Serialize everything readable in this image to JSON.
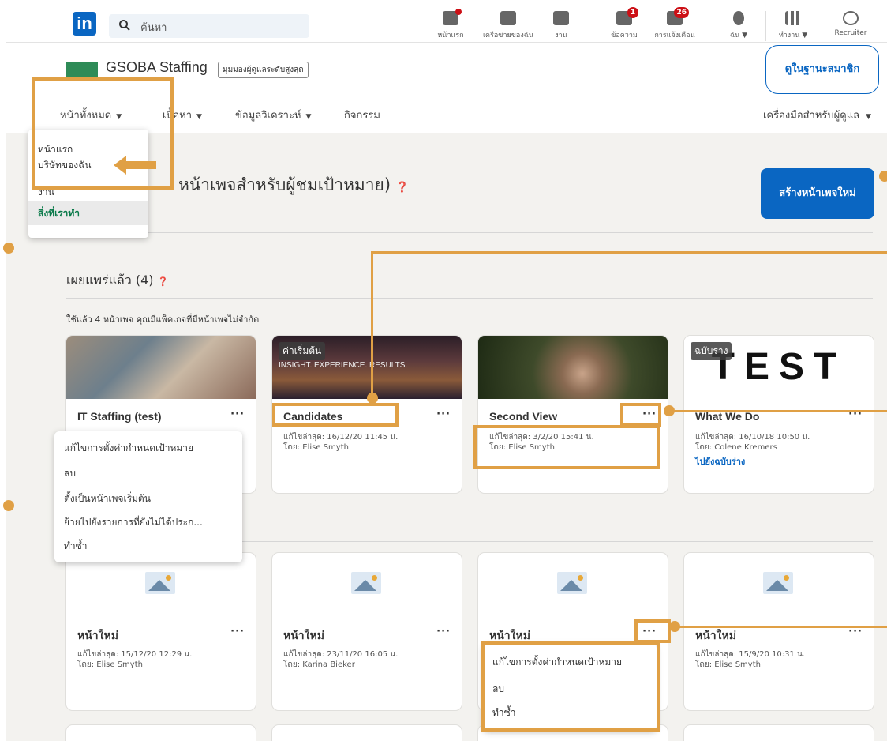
{
  "topnav": {
    "logo": "in",
    "search_placeholder": "ค้นหา",
    "items": [
      {
        "label": "หน้าแรก",
        "icon": "home-icon",
        "badge": ""
      },
      {
        "label": "เครือข่ายของฉัน",
        "icon": "network-icon",
        "badge": ""
      },
      {
        "label": "งาน",
        "icon": "briefcase-icon",
        "badge": ""
      },
      {
        "label": "ข้อความ",
        "icon": "message-icon",
        "badge": "1"
      },
      {
        "label": "การแจ้งเตือน",
        "icon": "bell-icon",
        "badge": "26"
      },
      {
        "label": "ฉัน ▼",
        "icon": "avatar-icon",
        "badge": ""
      },
      {
        "label": "ทำงาน ▼",
        "icon": "grid-icon",
        "badge": ""
      },
      {
        "label": "Recruiter",
        "icon": "recruiter-icon",
        "badge": ""
      }
    ]
  },
  "header": {
    "company_name": "GSOBA Staffing",
    "view_pill": "มุมมองผู้ดูแลระดับสูงสุด",
    "member_view": "ดูในฐานะสมาชิก",
    "tabs": [
      "หน้าทั้งหมด",
      "เนื้อหา",
      "ข้อมูลวิเคราะห์",
      "กิจกรรม"
    ],
    "admin_tools": "เครื่องมือสำหรับผู้ดูแล"
  },
  "pages_menu": {
    "items": [
      "หน้าแรก",
      "บริษัทของฉัน",
      "งาน",
      "สิ่งที่เราทำ"
    ]
  },
  "main": {
    "draft_title": "หน้าเพจสำหรับผู้ชมเป้าหมาย)",
    "create_button": "สร้างหน้าเพจใหม่",
    "published_title": "เผยแพร่แล้ว (4)",
    "usage_text": "ใช้แล้ว 4 หน้าเพจ คุณมีแพ็คเกจที่มีหน้าเพจไม่จำกัด",
    "published_cards": [
      {
        "title": "IT Staffing (test)",
        "meta1": "",
        "meta2": "",
        "status": "",
        "link": ""
      },
      {
        "title": "Candidates",
        "meta1": "แก้ไขล่าสุด: 16/12/20 11:45 น.",
        "meta2": "โดย: Elise Smyth",
        "status": "ค่าเริ่มต้น",
        "link": "",
        "img_text": "INSIGHT. EXPERIENCE. RESULTS."
      },
      {
        "title": "Second View",
        "meta1": "แก้ไขล่าสุด: 3/2/20 15:41 น.",
        "meta2": "โดย: Elise Smyth",
        "status": "",
        "link": ""
      },
      {
        "title": "What We Do",
        "meta1": "แก้ไขล่าสุด: 16/10/18 10:50 น.",
        "meta2": "โดย: Colene Kremers",
        "status": "ฉบับร่าง",
        "link": "ไปยังฉบับร่าง",
        "img_text": "TEST"
      }
    ],
    "card_menu": {
      "items": [
        "แก้ไขการตั้งค่ากำหนดเป้าหมาย",
        "ลบ",
        "ตั้งเป็นหน้าเพจเริ่มต้น",
        "ย้ายไปยังรายการที่ยังไม่ได้เผยแพร่",
        "ทำซ้ำ"
      ],
      "items_display": [
        "แก้ไขการตั้งค่ากำหนดเป้าหมาย",
        "ลบ",
        "ตั้งเป็นหน้าเพจเริ่มต้น",
        "ย้ายไปยังรายการที่ยังไม่ได้ประก...",
        "ทำซ้ำ"
      ]
    },
    "new_cards": [
      {
        "title": "หน้าใหม่",
        "meta1": "แก้ไขล่าสุด: 15/12/20 12:29 น.",
        "meta2": "โดย: Elise Smyth"
      },
      {
        "title": "หน้าใหม่",
        "meta1": "แก้ไขล่าสุด: 23/11/20 16:05 น.",
        "meta2": "โดย: Karina Bieker"
      },
      {
        "title": "หน้าใหม่",
        "meta1": "",
        "meta2": ""
      },
      {
        "title": "หน้าใหม่",
        "meta1": "แก้ไขล่าสุด: 15/9/20 10:31 น.",
        "meta2": "โดย: Elise Smyth"
      }
    ],
    "new_card_menu": {
      "items": [
        "แก้ไขการตั้งค่ากำหนดเป้าหมาย",
        "ลบ",
        "ทำซ้ำ"
      ]
    },
    "more_label": "···"
  },
  "colors": {
    "linkedin_blue": "#0a66c2",
    "annotation": "#e0a045",
    "page_bg": "#f3f2ef"
  }
}
